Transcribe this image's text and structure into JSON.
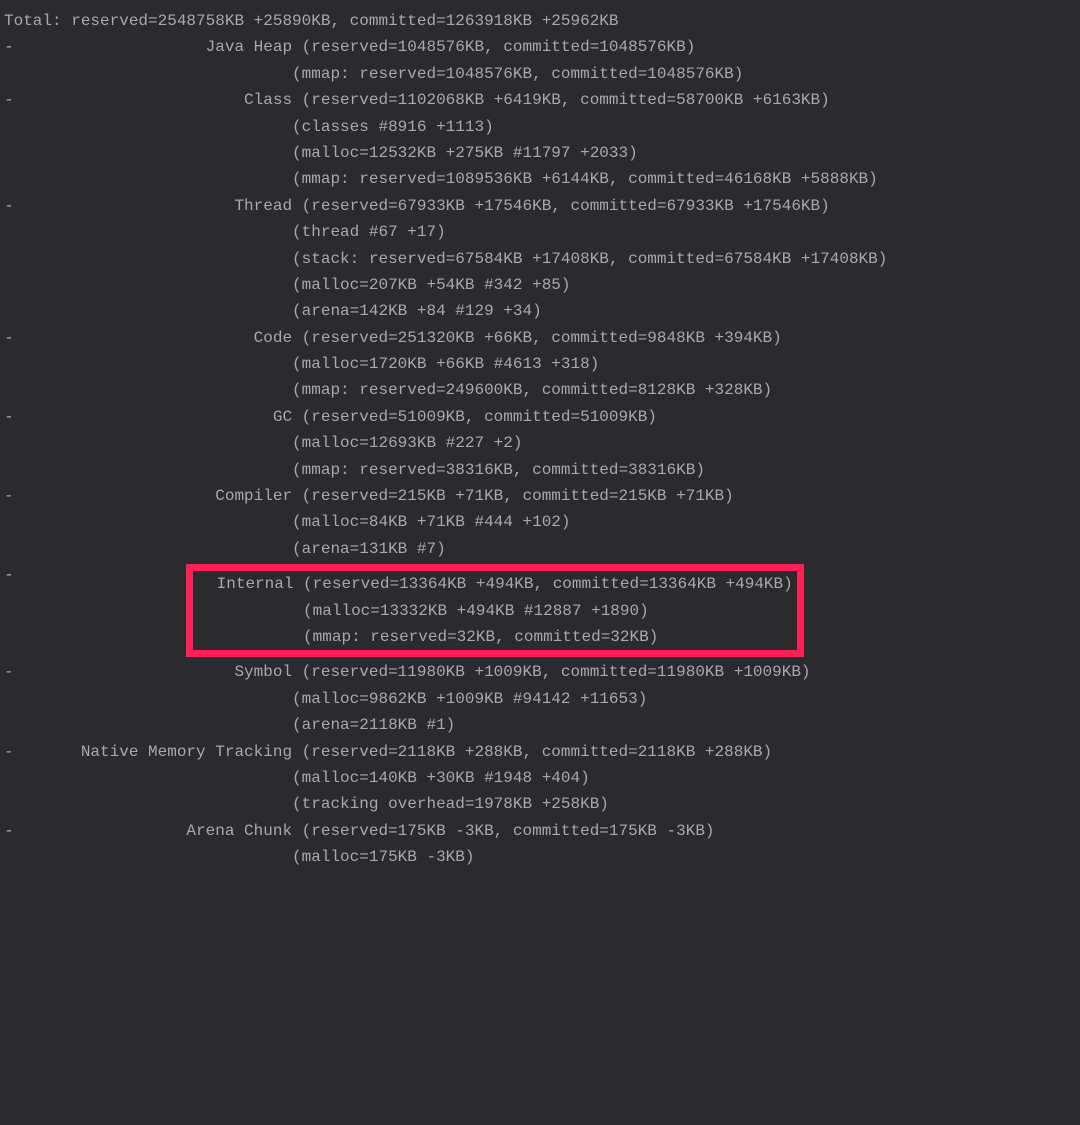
{
  "total": {
    "line": "Total: reserved=2548758KB +25890KB, committed=1263918KB +25962KB"
  },
  "sections": [
    {
      "name": "Java Heap",
      "header": "(reserved=1048576KB, committed=1048576KB)",
      "lines": [
        "(mmap: reserved=1048576KB, committed=1048576KB)"
      ],
      "highlight": false
    },
    {
      "name": "Class",
      "header": "(reserved=1102068KB +6419KB, committed=58700KB +6163KB)",
      "lines": [
        "(classes #8916 +1113)",
        "(malloc=12532KB +275KB #11797 +2033)",
        "(mmap: reserved=1089536KB +6144KB, committed=46168KB +5888KB)"
      ],
      "highlight": false
    },
    {
      "name": "Thread",
      "header": "(reserved=67933KB +17546KB, committed=67933KB +17546KB)",
      "lines": [
        "(thread #67 +17)",
        "(stack: reserved=67584KB +17408KB, committed=67584KB +17408KB)",
        "(malloc=207KB +54KB #342 +85)",
        "(arena=142KB +84 #129 +34)"
      ],
      "highlight": false
    },
    {
      "name": "Code",
      "header": "(reserved=251320KB +66KB, committed=9848KB +394KB)",
      "lines": [
        "(malloc=1720KB +66KB #4613 +318)",
        "(mmap: reserved=249600KB, committed=8128KB +328KB)"
      ],
      "highlight": false
    },
    {
      "name": "GC",
      "header": "(reserved=51009KB, committed=51009KB)",
      "lines": [
        "(malloc=12693KB #227 +2)",
        "(mmap: reserved=38316KB, committed=38316KB)"
      ],
      "highlight": false
    },
    {
      "name": "Compiler",
      "header": "(reserved=215KB +71KB, committed=215KB +71KB)",
      "lines": [
        "(malloc=84KB +71KB #444 +102)",
        "(arena=131KB #7)"
      ],
      "highlight": false
    },
    {
      "name": "Internal",
      "header": "(reserved=13364KB +494KB, committed=13364KB +494KB)",
      "lines": [
        "(malloc=13332KB +494KB #12887 +1890)",
        "(mmap: reserved=32KB, committed=32KB)"
      ],
      "highlight": true
    },
    {
      "name": "Symbol",
      "header": "(reserved=11980KB +1009KB, committed=11980KB +1009KB)",
      "lines": [
        "(malloc=9862KB +1009KB #94142 +11653)",
        "(arena=2118KB #1)"
      ],
      "highlight": false
    },
    {
      "name": "Native Memory Tracking",
      "header": "(reserved=2118KB +288KB, committed=2118KB +288KB)",
      "lines": [
        "(malloc=140KB +30KB #1948 +404)",
        "(tracking overhead=1978KB +258KB)"
      ],
      "highlight": false
    },
    {
      "name": "Arena Chunk",
      "header": "(reserved=175KB -3KB, committed=175KB -3KB)",
      "lines": [
        "(malloc=175KB -3KB)"
      ],
      "highlight": false
    }
  ],
  "layout": {
    "labelWidth": 29,
    "contentIndent": 30
  }
}
